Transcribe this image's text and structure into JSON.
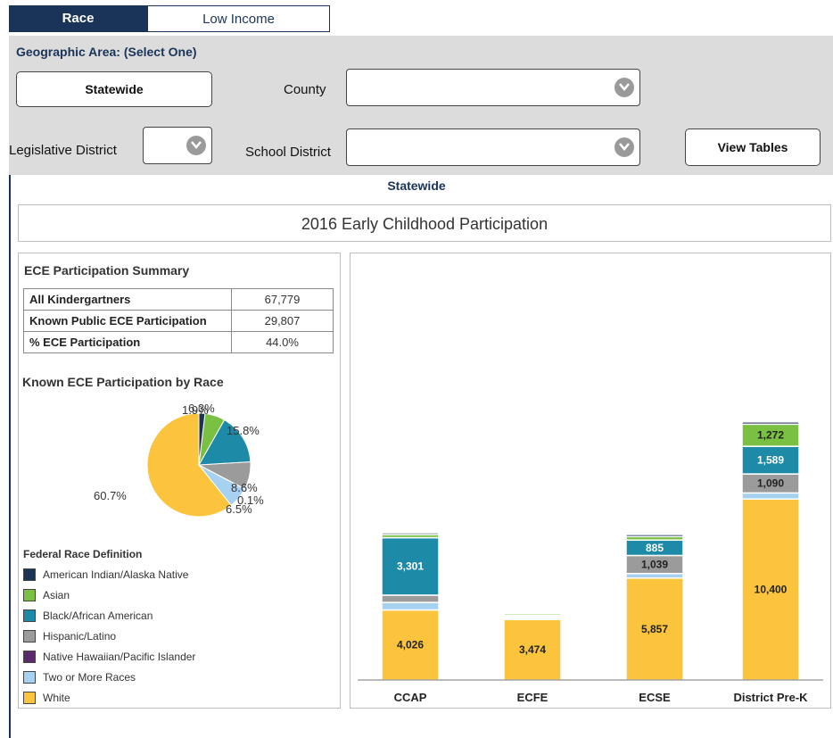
{
  "tabs": {
    "race": "Race",
    "low_income": "Low Income"
  },
  "filters": {
    "geo_label": "Geographic Area: (Select One)",
    "statewide_button": "Statewide",
    "county_label": "County",
    "legislative_label": "Legislative District",
    "school_district_label": "School District",
    "view_tables_button": "View Tables"
  },
  "selected_area": "Statewide",
  "title": "2016 Early Childhood Participation",
  "summary": {
    "title": "ECE Participation Summary",
    "rows": [
      {
        "label": "All Kindergartners",
        "value": "67,779"
      },
      {
        "label": "Known Public ECE Participation",
        "value": "29,807"
      },
      {
        "label": "% ECE Participation",
        "value": "44.0%"
      }
    ]
  },
  "pie": {
    "title": "Known ECE Participation by Race",
    "labels": [
      "1.9%",
      "6.3%",
      "15.8%",
      "8.6%",
      "0.1%",
      "6.5%",
      "60.7%"
    ]
  },
  "legend": {
    "title": "Federal Race Definition",
    "items": [
      {
        "label": "American Indian/Alaska Native",
        "color": "#1b3355"
      },
      {
        "label": "Asian",
        "color": "#7ac143"
      },
      {
        "label": "Black/African American",
        "color": "#1d8aa8"
      },
      {
        "label": "Hispanic/Latino",
        "color": "#9b9b9b"
      },
      {
        "label": "Native Hawaiian/Pacific Islander",
        "color": "#5a2a6b"
      },
      {
        "label": "Two or More Races",
        "color": "#a7d1f0"
      },
      {
        "label": "White",
        "color": "#fbc43c"
      }
    ]
  },
  "chart_data": [
    {
      "type": "pie",
      "title": "Known ECE Participation by Race",
      "series": [
        "American Indian/Alaska Native",
        "Asian",
        "Black/African American",
        "Hispanic/Latino",
        "Native Hawaiian/Pacific Islander",
        "Two or More Races",
        "White"
      ],
      "values": [
        1.9,
        6.3,
        15.8,
        8.6,
        0.1,
        6.5,
        60.7
      ]
    },
    {
      "type": "bar",
      "stacked": true,
      "categories": [
        "CCAP",
        "ECFE",
        "ECSE",
        "District Pre-K"
      ],
      "series": [
        {
          "name": "White",
          "values": [
            4026,
            3474,
            5857,
            10400
          ]
        },
        {
          "name": "Two or More Races",
          "values": [
            430,
            90,
            260,
            350
          ]
        },
        {
          "name": "Hispanic/Latino",
          "values": [
            420,
            70,
            1039,
            1090
          ]
        },
        {
          "name": "Black/African American",
          "values": [
            3301,
            80,
            885,
            1589
          ]
        },
        {
          "name": "Asian",
          "values": [
            180,
            100,
            200,
            1272
          ]
        },
        {
          "name": "American Indian/Alaska Native",
          "values": [
            100,
            60,
            120,
            130
          ]
        }
      ],
      "value_labels": [
        {
          "category": "CCAP",
          "series": "White",
          "text": "4,026"
        },
        {
          "category": "CCAP",
          "series": "Black/African American",
          "text": "3,301"
        },
        {
          "category": "ECFE",
          "series": "White",
          "text": "3,474"
        },
        {
          "category": "ECSE",
          "series": "White",
          "text": "5,857"
        },
        {
          "category": "ECSE",
          "series": "Hispanic/Latino",
          "text": "1,039"
        },
        {
          "category": "ECSE",
          "series": "Black/African American",
          "text": "885"
        },
        {
          "category": "District Pre-K",
          "series": "White",
          "text": "10,400"
        },
        {
          "category": "District Pre-K",
          "series": "Hispanic/Latino",
          "text": "1,090"
        },
        {
          "category": "District Pre-K",
          "series": "Black/African American",
          "text": "1,589"
        },
        {
          "category": "District Pre-K",
          "series": "Asian",
          "text": "1,272"
        }
      ]
    }
  ]
}
